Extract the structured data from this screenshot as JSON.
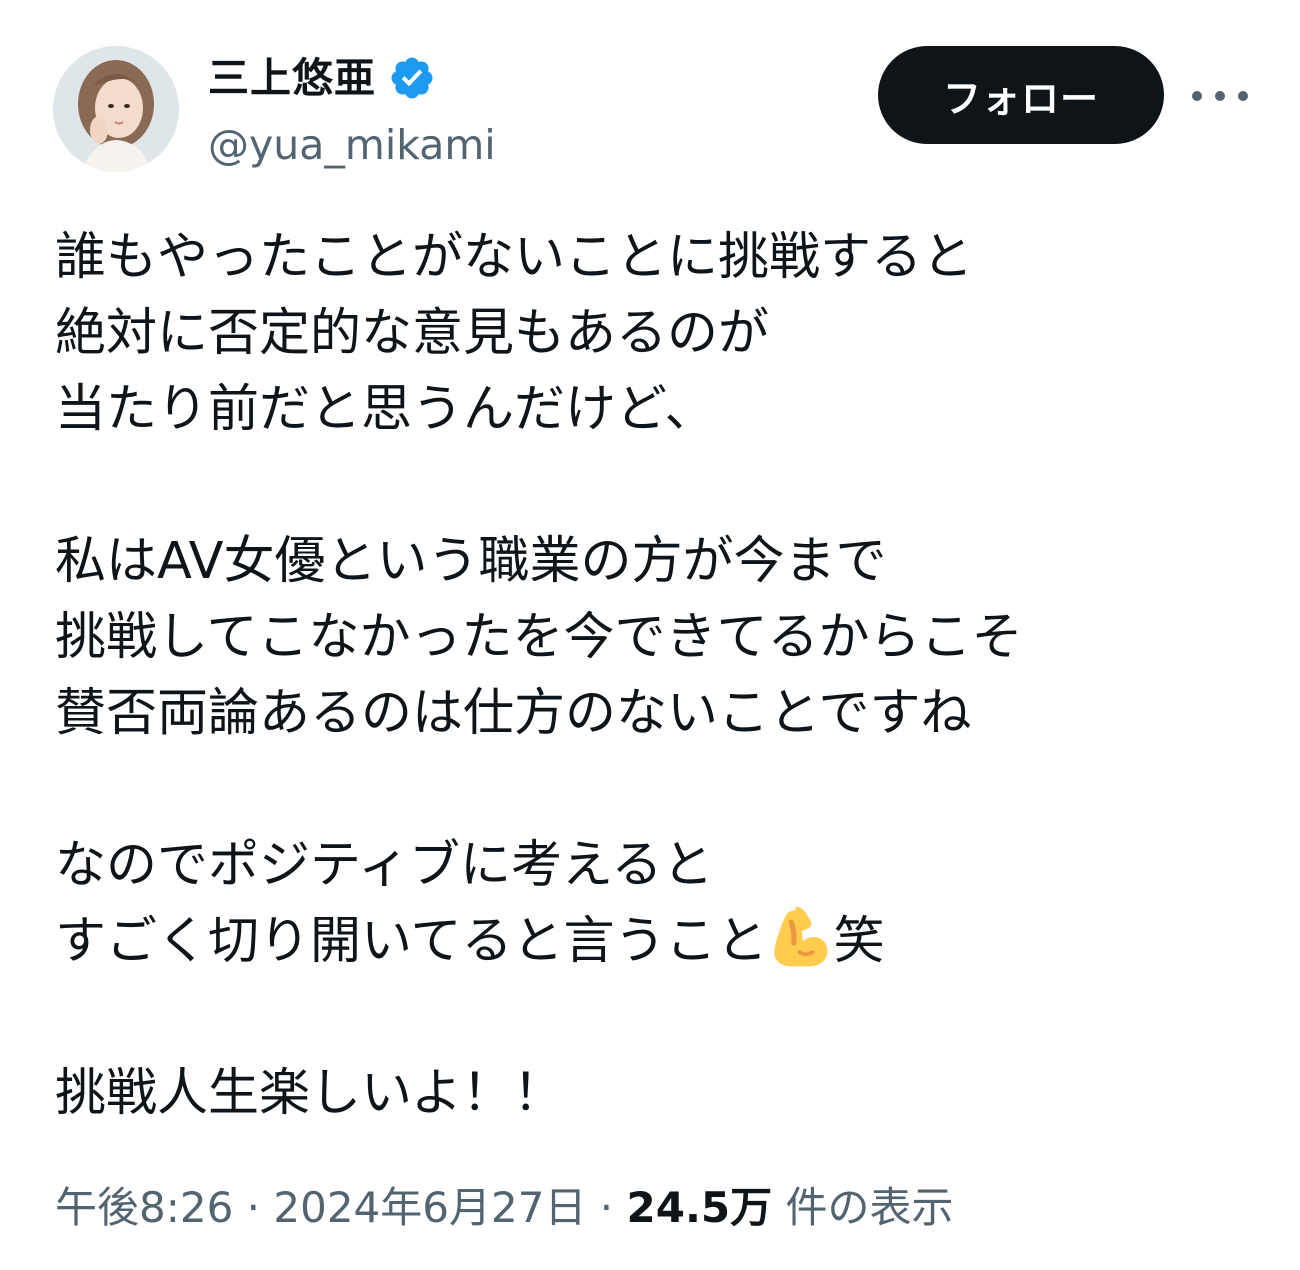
{
  "author": {
    "display_name": "三上悠亜",
    "handle": "@yua_mikami",
    "verified": true,
    "verified_color": "#1d9bf0"
  },
  "actions": {
    "follow_label": "フォロー",
    "more_icon": "more-horizontal-icon"
  },
  "tweet": {
    "paragraphs": [
      [
        "誰もやったことがないことに挑戦すると",
        "絶対に否定的な意見もあるのが",
        "当たり前だと思うんだけど、"
      ],
      [
        "私はAV女優という職業の方が今まで",
        "挑戦してこなかったを今できてるからこそ",
        "賛否両論あるのは仕方のないことですね"
      ],
      [
        "なのでポジティブに考えると",
        "すごく切り開いてると言うこと",
        "挑戦人生楽しいよ！！"
      ]
    ],
    "line_8_before_emoji": "すごく切り開いてると言うこと",
    "line_8_after_emoji": "笑",
    "emoji": "flexed-biceps-emoji"
  },
  "meta": {
    "time": "午後8:26",
    "separator": " · ",
    "date": "2024年6月27日",
    "views_count": "24.5万",
    "views_label": "件の表示"
  }
}
